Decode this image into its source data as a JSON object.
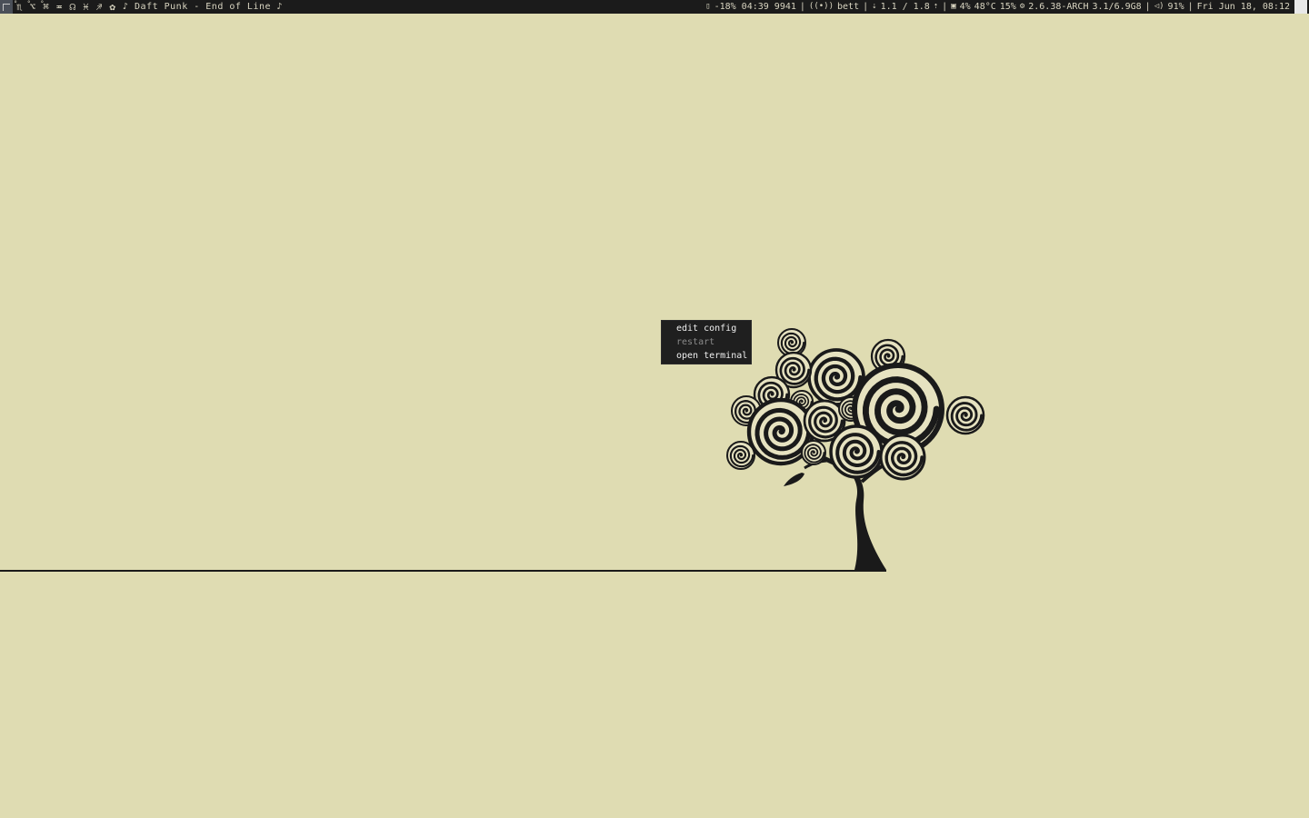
{
  "topbar": {
    "workspaces": [
      {
        "glyph": "♏",
        "mark": "°"
      },
      {
        "glyph": "⌥",
        "mark": "°"
      },
      {
        "glyph": "⌘",
        "mark": "°"
      },
      {
        "glyph": "≖",
        "mark": ""
      },
      {
        "glyph": "☊",
        "mark": ""
      },
      {
        "glyph": "♓",
        "mark": ""
      },
      {
        "glyph": "♐",
        "mark": ""
      },
      {
        "glyph": "✿",
        "mark": ""
      }
    ],
    "now_playing": "♪ Daft Punk - End of Line ♪",
    "status": {
      "battery": "-18% 04:39 9941",
      "wifi": "bett",
      "net": "1.1 / 1.8",
      "cpu": "4%",
      "temp": "48°C",
      "mem": "15%",
      "kernel": "2.6.38-ARCH",
      "disk": "3.1/6.9G8",
      "volume": "91%",
      "datetime": "Fri Jun 18, 08:12"
    },
    "separator": "|"
  },
  "context_menu": {
    "items": [
      {
        "label": "edit config",
        "enabled": true
      },
      {
        "label": "restart",
        "enabled": false
      },
      {
        "label": "open terminal",
        "enabled": true
      }
    ]
  },
  "colors": {
    "desktop_bg": "#dfdcb2",
    "bar_bg": "#1b1b1b",
    "menu_bg": "#1f1f1f",
    "ink": "#1a1a1a"
  },
  "icons": {
    "battery": "battery-icon",
    "wifi": "wifi-icon",
    "net": "network-icon",
    "cpu": "cpu-icon",
    "kernel": "gear-icon",
    "volume": "volume-icon"
  }
}
